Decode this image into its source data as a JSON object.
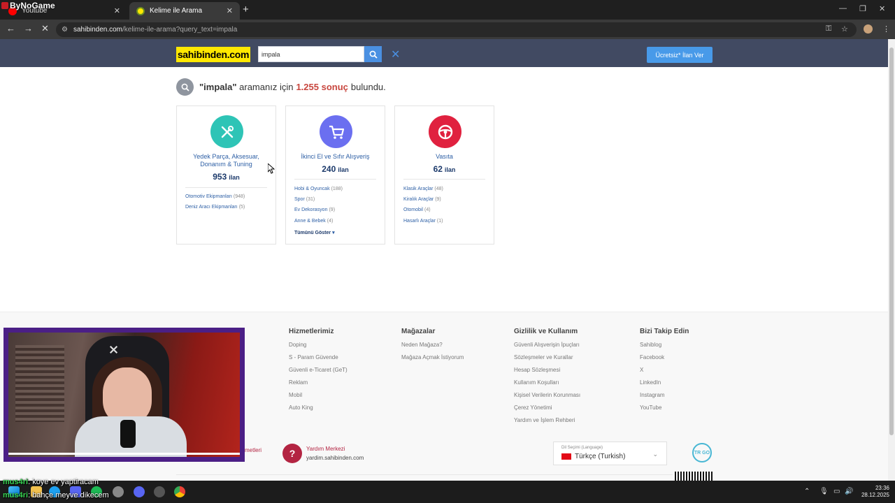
{
  "stream": {
    "logo": "ByNoGame"
  },
  "browser": {
    "tabs": [
      {
        "label": "Youtube",
        "active": false
      },
      {
        "label": "Kelime ile Arama",
        "active": true
      }
    ],
    "url_host": "sahibinden.com",
    "url_path": "/kelime-ile-arama?query_text=impala"
  },
  "header": {
    "logo": "sahibinden.com",
    "search_value": "impala",
    "post_ad": "Ücretsiz* İlan Ver"
  },
  "result": {
    "query": "\"impala\"",
    "before": "aramanız için",
    "count": "1.255 sonuç",
    "after": "bulundu."
  },
  "categories": [
    {
      "name": "Yedek Parça, Aksesuar, Donanım & Tuning",
      "count": "953",
      "unit": "ilan",
      "icon": "tools-icon",
      "color": "#2ec4b6",
      "items": [
        {
          "label": "Otomotiv Ekipmanları",
          "count": "(948)"
        },
        {
          "label": "Deniz Aracı Ekipmanları",
          "count": "(5)"
        }
      ]
    },
    {
      "name": "İkinci El ve Sıfır Alışveriş",
      "count": "240",
      "unit": "ilan",
      "icon": "cart-icon",
      "color": "#6b6ff0",
      "items": [
        {
          "label": "Hobi & Oyuncak",
          "count": "(188)"
        },
        {
          "label": "Spor",
          "count": "(31)"
        },
        {
          "label": "Ev Dekorasyon",
          "count": "(9)"
        },
        {
          "label": "Anne & Bebek",
          "count": "(4)"
        }
      ],
      "more": "Tümünü Göster"
    },
    {
      "name": "Vasıta",
      "count": "62",
      "unit": "ilan",
      "icon": "steering-wheel-icon",
      "color": "#e0213f",
      "items": [
        {
          "label": "Klasik Araçlar",
          "count": "(48)"
        },
        {
          "label": "Kiralık Araçlar",
          "count": "(9)"
        },
        {
          "label": "Otomobil",
          "count": "(4)"
        },
        {
          "label": "Hasarlı Araçlar",
          "count": "(1)"
        }
      ]
    }
  ],
  "footer": {
    "columns": [
      {
        "title": "Hizmetlerimiz",
        "links": [
          "Doping",
          "S - Param Güvende",
          "Güvenli e-Ticaret (GeT)",
          "Reklam",
          "Mobil",
          "Auto King"
        ]
      },
      {
        "title": "Mağazalar",
        "links": [
          "Neden Mağaza?",
          "Mağaza Açmak İstiyorum"
        ]
      },
      {
        "title": "Gizlilik ve Kullanım",
        "links": [
          "Güvenli Alışverişin İpuçları",
          "Sözleşmeler ve Kurallar",
          "Hesap Sözleşmesi",
          "Kullanım Koşulları",
          "Kişisel Verilerin Korunması",
          "Çerez Yönetimi",
          "Yardım ve İşlem Rehberi"
        ]
      },
      {
        "title": "Bizi Takip Edin",
        "links": [
          "Sahiblog",
          "Facebook",
          "X",
          "LinkedIn",
          "Instagram",
          "YouTube"
        ]
      }
    ],
    "cut_text": "metleri",
    "help_title": "Yardım Merkezi",
    "help_site": "yardim.sahibinden.com",
    "lang_label": "Dil Seçimi (Language)",
    "lang_value": "Türkçe (Turkish)",
    "trgo": "TR GO"
  },
  "chat": [
    {
      "user": "mus4ri",
      "text": ": koye ev yaptiracam"
    },
    {
      "user": "mus4ri",
      "text": ": bahçe meyve dikecem"
    }
  ],
  "taskbar": {
    "time": "23:36",
    "date": "28.12.2025"
  }
}
